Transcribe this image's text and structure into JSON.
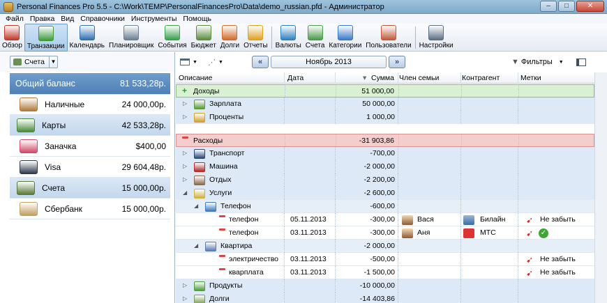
{
  "window": {
    "title": "Personal Finances Pro 5.5 - C:\\Work\\TEMP\\PersonalFinancesPro\\Data\\demo_russian.pfd - Администратор"
  },
  "menu": [
    "Файл",
    "Правка",
    "Вид",
    "Справочники",
    "Инструменты",
    "Помощь"
  ],
  "toolbar": [
    {
      "label": "Обзор",
      "icon": "overview-icon",
      "color": "#c0392b"
    },
    {
      "label": "Транзакции",
      "icon": "transactions-icon",
      "color": "#3c9a3c",
      "active": true
    },
    {
      "label": "Календарь",
      "icon": "calendar-icon",
      "color": "#2f6fb0"
    },
    {
      "label": "Планировщик",
      "icon": "scheduler-icon",
      "color": "#6a7f93"
    },
    {
      "label": "События",
      "icon": "events-icon",
      "color": "#3aa04a"
    },
    {
      "label": "Бюджет",
      "icon": "budget-icon",
      "color": "#5b8c3e"
    },
    {
      "label": "Долги",
      "icon": "debts-icon",
      "color": "#d26a2a"
    },
    {
      "label": "Отчеты",
      "icon": "reports-icon",
      "color": "#e0a020"
    },
    {
      "label": "Валюты",
      "icon": "currencies-icon",
      "color": "#2c7fc0"
    },
    {
      "label": "Счета",
      "icon": "accounts-icon",
      "color": "#4a9a4a"
    },
    {
      "label": "Категории",
      "icon": "categories-icon",
      "color": "#3a78c8"
    },
    {
      "label": "Пользователи",
      "icon": "users-icon",
      "color": "#c05a3a"
    },
    {
      "label": "Настройки",
      "icon": "settings-icon",
      "color": "#5a6e82"
    }
  ],
  "accounts_selector": {
    "label": "Счета"
  },
  "accounts": {
    "total": {
      "label": "Общий баланс",
      "amount": "81 533,28р."
    },
    "items": [
      {
        "label": "Наличные",
        "amount": "24 000,00р.",
        "group": false,
        "icon": "cash-icon",
        "color": "#b07a3a"
      },
      {
        "label": "Карты",
        "amount": "42 533,28р.",
        "group": true,
        "icon": "cards-icon",
        "color": "#4a8a3a"
      },
      {
        "label": "Заначка",
        "amount": "$400,00",
        "group": false,
        "icon": "piggy-bank-icon",
        "color": "#d04a6a"
      },
      {
        "label": "Visa",
        "amount": "29 604,48р.",
        "group": false,
        "icon": "card-icon",
        "color": "#2e3a4a"
      },
      {
        "label": "Счета",
        "amount": "15 000,00р.",
        "group": true,
        "icon": "bank-accounts-icon",
        "color": "#5a7a3a"
      },
      {
        "label": "Сбербанк",
        "amount": "15 000,00р.",
        "group": false,
        "icon": "safe-icon",
        "color": "#c0a060"
      }
    ]
  },
  "period": {
    "label": "Ноябрь 2013",
    "filters_label": "Фильтры"
  },
  "columns": [
    "Описание",
    "Дата",
    "Сумма",
    "Член семьи",
    "Контрагент",
    "Метки"
  ],
  "rows": [
    {
      "kind": "inc",
      "desc": "Доходы",
      "date": "",
      "sum": "51 000,00",
      "member": "",
      "party": "",
      "tag": "",
      "indent": 0,
      "mark": "plus"
    },
    {
      "kind": "sub",
      "desc": "Зарплата",
      "date": "",
      "sum": "50 000,00",
      "member": "",
      "party": "",
      "tag": "",
      "indent": 1,
      "icon": "salary-icon",
      "color": "#5a9a3a"
    },
    {
      "kind": "sub",
      "desc": "Проценты",
      "date": "",
      "sum": "1 000,00",
      "member": "",
      "party": "",
      "tag": "",
      "indent": 1,
      "icon": "interest-icon",
      "color": "#d0a030"
    },
    {
      "kind": "gap"
    },
    {
      "kind": "exp",
      "desc": "Расходы",
      "date": "",
      "sum": "-31 903,86",
      "member": "",
      "party": "",
      "tag": "",
      "indent": 0,
      "mark": "minus"
    },
    {
      "kind": "sub",
      "desc": "Транспорт",
      "date": "",
      "sum": "-700,00",
      "member": "",
      "party": "",
      "tag": "",
      "indent": 1,
      "icon": "transport-icon",
      "color": "#2a4a7a"
    },
    {
      "kind": "sub",
      "desc": "Машина",
      "date": "",
      "sum": "-2 000,00",
      "member": "",
      "party": "",
      "tag": "",
      "indent": 1,
      "icon": "car-icon",
      "color": "#b02a2a"
    },
    {
      "kind": "sub",
      "desc": "Отдых",
      "date": "",
      "sum": "-2 200,00",
      "member": "",
      "party": "",
      "tag": "",
      "indent": 1,
      "icon": "rest-icon",
      "color": "#8a6a4a"
    },
    {
      "kind": "sub",
      "desc": "Услуги",
      "date": "",
      "sum": "-2 600,00",
      "member": "",
      "party": "",
      "tag": "",
      "indent": 1,
      "icon": "services-icon",
      "color": "#d0b040",
      "open": true
    },
    {
      "kind": "sub2",
      "desc": "Телефон",
      "date": "",
      "sum": "-600,00",
      "member": "",
      "party": "",
      "tag": "",
      "indent": 2,
      "icon": "phone-icon",
      "color": "#3a7ac0",
      "open": true
    },
    {
      "kind": "leaf",
      "desc": "телефон",
      "date": "05.11.2013",
      "sum": "-300,00",
      "member": "Вася",
      "party": "Билайн",
      "tag": "Не забыть",
      "indent": 3,
      "member_icon": "person-icon",
      "party_icon": "beeline-icon",
      "tag_icon": "pin-icon"
    },
    {
      "kind": "leaf",
      "desc": "телефон",
      "date": "03.11.2013",
      "sum": "-300,00",
      "member": "Аня",
      "party": "МТС",
      "tag": "",
      "indent": 3,
      "member_icon": "person-icon",
      "party_icon": "mts-icon",
      "tag_icon": "pin-icon",
      "tag2_icon": "check-icon"
    },
    {
      "kind": "sub2",
      "desc": "Квартира",
      "date": "",
      "sum": "-2 000,00",
      "member": "",
      "party": "",
      "tag": "",
      "indent": 2,
      "icon": "apartment-icon",
      "color": "#5a7ab0",
      "open": true
    },
    {
      "kind": "leaf",
      "desc": "электричество",
      "date": "03.11.2013",
      "sum": "-500,00",
      "member": "",
      "party": "",
      "tag": "Не забыть",
      "indent": 3,
      "tag_icon": "pin-icon"
    },
    {
      "kind": "leaf",
      "desc": "кварплата",
      "date": "03.11.2013",
      "sum": "-1 500,00",
      "member": "",
      "party": "",
      "tag": "Не забыть",
      "indent": 3,
      "tag_icon": "pin-icon"
    },
    {
      "kind": "sub",
      "desc": "Продукты",
      "date": "",
      "sum": "-10 000,00",
      "member": "",
      "party": "",
      "tag": "",
      "indent": 1,
      "icon": "groceries-icon",
      "color": "#4aa03a"
    },
    {
      "kind": "sub",
      "desc": "Долги",
      "date": "",
      "sum": "-14 403,86",
      "member": "",
      "party": "",
      "tag": "",
      "indent": 1,
      "icon": "debts-icon",
      "color": "#7a9a5a"
    }
  ]
}
